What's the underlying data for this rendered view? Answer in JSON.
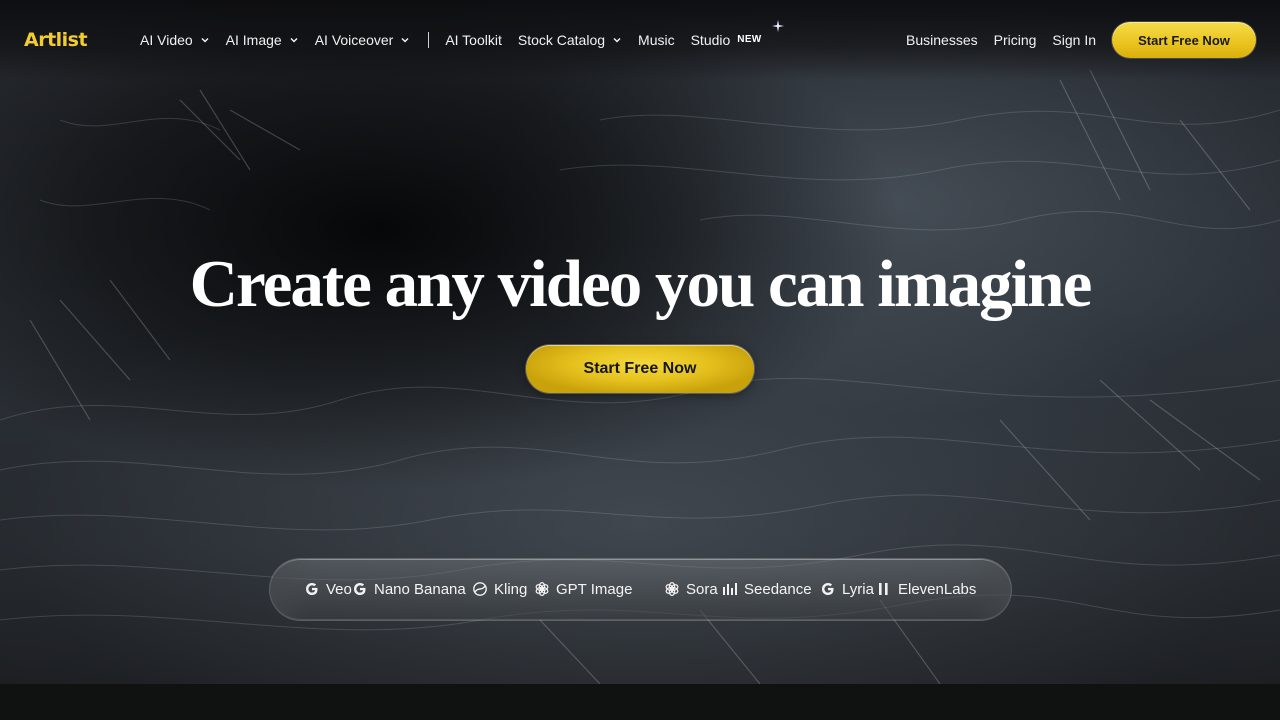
{
  "brand": {
    "logo_text": "Artlist",
    "accent_color": "#f3cd2f"
  },
  "nav": {
    "left_items": [
      {
        "label": "AI Video",
        "icon": "chevron-down-icon"
      },
      {
        "label": "AI Image",
        "icon": "chevron-down-icon"
      },
      {
        "label": "AI Voiceover",
        "icon": "chevron-down-icon"
      }
    ],
    "middle_items": [
      {
        "label": "AI Toolkit"
      },
      {
        "label": "Stock Catalog",
        "icon": "chevron-down-icon"
      },
      {
        "label": "Music"
      },
      {
        "label": "Studio",
        "badge": "NEW",
        "badge_icon": "sparkle-icon"
      }
    ],
    "right_items": [
      {
        "label": "Businesses"
      },
      {
        "label": "Pricing"
      },
      {
        "label": "Sign In"
      }
    ],
    "cta_label": "Start Free Now"
  },
  "hero": {
    "headline": "Create any video you can imagine",
    "cta_label": "Start Free Now"
  },
  "models": [
    {
      "label": "Veo",
      "icon": "google-icon"
    },
    {
      "label": "Nano Banana",
      "icon": "google-icon"
    },
    {
      "label": "Kling",
      "icon": "kling-icon"
    },
    {
      "label": "GPT Image",
      "icon": "openai-icon"
    },
    {
      "label": "Sora",
      "icon": "openai-icon"
    },
    {
      "label": "Seedance",
      "icon": "bars-icon"
    },
    {
      "label": "Lyria",
      "icon": "google-icon"
    },
    {
      "label": "ElevenLabs",
      "icon": "elevenlabs-icon"
    }
  ]
}
